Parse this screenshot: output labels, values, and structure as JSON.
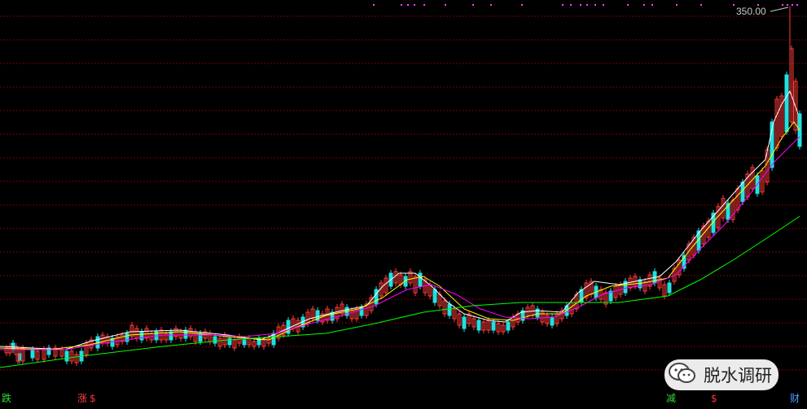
{
  "chart_data": {
    "type": "candlestick",
    "peak_label": "350.00",
    "y_scale": "linear",
    "grid": true,
    "series": [
      {
        "name": "",
        "color": "#ffffff"
      },
      {
        "name": "",
        "color": "#ffff00"
      },
      {
        "name": "",
        "color": "#ff00ff"
      },
      {
        "name": "",
        "color": "#00ff00"
      }
    ],
    "candles": [
      [
        26,
        428,
        16
      ],
      [
        22,
        435,
        8
      ],
      [
        20,
        430,
        14
      ],
      [
        18,
        426,
        10
      ],
      [
        14,
        422,
        8
      ],
      [
        10,
        426,
        8
      ],
      [
        6,
        428,
        6
      ],
      [
        38,
        430,
        10
      ],
      [
        44,
        432,
        10
      ],
      [
        52,
        430,
        12
      ],
      [
        58,
        428,
        8
      ],
      [
        66,
        428,
        10
      ],
      [
        74,
        430,
        8
      ],
      [
        80,
        432,
        12
      ],
      [
        86,
        432,
        12
      ],
      [
        92,
        436,
        10
      ],
      [
        98,
        432,
        12
      ],
      [
        104,
        422,
        14
      ],
      [
        110,
        418,
        10
      ],
      [
        118,
        414,
        14
      ],
      [
        124,
        412,
        10
      ],
      [
        130,
        414,
        8
      ],
      [
        136,
        416,
        10
      ],
      [
        142,
        414,
        10
      ],
      [
        148,
        412,
        8
      ],
      [
        154,
        410,
        10
      ],
      [
        160,
        400,
        14
      ],
      [
        166,
        404,
        12
      ],
      [
        172,
        408,
        10
      ],
      [
        178,
        404,
        12
      ],
      [
        184,
        410,
        8
      ],
      [
        190,
        408,
        10
      ],
      [
        196,
        406,
        12
      ],
      [
        202,
        410,
        8
      ],
      [
        208,
        408,
        10
      ],
      [
        214,
        404,
        10
      ],
      [
        220,
        408,
        8
      ],
      [
        226,
        406,
        10
      ],
      [
        232,
        404,
        10
      ],
      [
        238,
        408,
        12
      ],
      [
        244,
        410,
        10
      ],
      [
        250,
        408,
        8
      ],
      [
        256,
        410,
        10
      ],
      [
        262,
        414,
        8
      ],
      [
        268,
        416,
        10
      ],
      [
        274,
        412,
        12
      ],
      [
        280,
        416,
        8
      ],
      [
        286,
        418,
        10
      ],
      [
        292,
        414,
        8
      ],
      [
        298,
        418,
        6
      ],
      [
        304,
        416,
        8
      ],
      [
        310,
        420,
        6
      ],
      [
        316,
        416,
        8
      ],
      [
        322,
        418,
        8
      ],
      [
        328,
        416,
        6
      ],
      [
        334,
        410,
        14
      ],
      [
        340,
        402,
        14
      ],
      [
        346,
        400,
        12
      ],
      [
        352,
        394,
        16
      ],
      [
        358,
        392,
        12
      ],
      [
        364,
        394,
        14
      ],
      [
        370,
        390,
        12
      ],
      [
        376,
        384,
        14
      ],
      [
        382,
        380,
        12
      ],
      [
        388,
        382,
        12
      ],
      [
        394,
        386,
        10
      ],
      [
        400,
        380,
        14
      ],
      [
        406,
        384,
        10
      ],
      [
        412,
        378,
        14
      ],
      [
        418,
        374,
        12
      ],
      [
        424,
        378,
        10
      ],
      [
        430,
        382,
        10
      ],
      [
        436,
        380,
        12
      ],
      [
        442,
        378,
        10
      ],
      [
        448,
        374,
        14
      ],
      [
        454,
        366,
        16
      ],
      [
        460,
        356,
        18
      ],
      [
        466,
        348,
        16
      ],
      [
        472,
        342,
        18
      ],
      [
        478,
        336,
        16
      ],
      [
        484,
        334,
        14
      ],
      [
        490,
        338,
        12
      ],
      [
        496,
        340,
        12
      ],
      [
        502,
        334,
        14
      ],
      [
        508,
        340,
        20
      ],
      [
        514,
        336,
        16
      ],
      [
        520,
        344,
        16
      ],
      [
        526,
        350,
        14
      ],
      [
        532,
        356,
        16
      ],
      [
        538,
        362,
        14
      ],
      [
        544,
        370,
        16
      ],
      [
        550,
        374,
        14
      ],
      [
        556,
        380,
        12
      ],
      [
        562,
        386,
        14
      ],
      [
        568,
        390,
        14
      ],
      [
        574,
        386,
        12
      ],
      [
        580,
        392,
        10
      ],
      [
        586,
        394,
        12
      ],
      [
        592,
        396,
        10
      ],
      [
        598,
        394,
        12
      ],
      [
        604,
        396,
        10
      ],
      [
        610,
        398,
        10
      ],
      [
        616,
        400,
        8
      ],
      [
        622,
        396,
        10
      ],
      [
        628,
        390,
        12
      ],
      [
        634,
        386,
        10
      ],
      [
        640,
        382,
        12
      ],
      [
        646,
        378,
        10
      ],
      [
        652,
        376,
        12
      ],
      [
        658,
        380,
        10
      ],
      [
        664,
        384,
        12
      ],
      [
        670,
        388,
        10
      ],
      [
        676,
        390,
        10
      ],
      [
        682,
        386,
        12
      ],
      [
        688,
        382,
        10
      ],
      [
        694,
        376,
        12
      ],
      [
        700,
        372,
        14
      ],
      [
        706,
        362,
        18
      ],
      [
        712,
        356,
        16
      ],
      [
        718,
        348,
        18
      ],
      [
        724,
        346,
        16
      ],
      [
        730,
        352,
        14
      ],
      [
        736,
        356,
        12
      ],
      [
        742,
        360,
        14
      ],
      [
        748,
        358,
        12
      ],
      [
        754,
        352,
        14
      ],
      [
        760,
        350,
        12
      ],
      [
        766,
        346,
        14
      ],
      [
        772,
        342,
        12
      ],
      [
        778,
        340,
        12
      ],
      [
        784,
        344,
        10
      ],
      [
        790,
        346,
        12
      ],
      [
        796,
        338,
        14
      ],
      [
        802,
        334,
        14
      ],
      [
        808,
        342,
        12
      ],
      [
        814,
        350,
        14
      ],
      [
        820,
        348,
        12
      ],
      [
        826,
        330,
        16
      ],
      [
        832,
        320,
        18
      ],
      [
        838,
        314,
        16
      ],
      [
        844,
        300,
        20
      ],
      [
        850,
        292,
        22
      ],
      [
        856,
        284,
        24
      ],
      [
        862,
        278,
        22
      ],
      [
        868,
        272,
        20
      ],
      [
        874,
        262,
        24
      ],
      [
        880,
        254,
        26
      ],
      [
        886,
        244,
        24
      ],
      [
        892,
        250,
        20
      ],
      [
        898,
        246,
        24
      ],
      [
        904,
        232,
        26
      ],
      [
        910,
        224,
        24
      ],
      [
        916,
        214,
        28
      ],
      [
        922,
        206,
        26
      ],
      [
        928,
        216,
        22
      ],
      [
        934,
        210,
        26
      ],
      [
        940,
        184,
        40
      ],
      [
        946,
        150,
        56
      ],
      [
        952,
        122,
        60
      ],
      [
        958,
        118,
        50
      ],
      [
        964,
        92,
        70
      ],
      [
        970,
        60,
        90
      ],
      [
        975,
        100,
        60
      ],
      [
        980,
        140,
        40
      ]
    ],
    "ma_lines": [
      {
        "name": "",
        "color": "#ffffff",
        "points": [
          [
            0,
            426
          ],
          [
            40,
            428
          ],
          [
            80,
            430
          ],
          [
            110,
            420
          ],
          [
            160,
            408
          ],
          [
            220,
            406
          ],
          [
            280,
            412
          ],
          [
            320,
            418
          ],
          [
            340,
            410
          ],
          [
            380,
            392
          ],
          [
            420,
            382
          ],
          [
            450,
            376
          ],
          [
            470,
            352
          ],
          [
            490,
            336
          ],
          [
            510,
            336
          ],
          [
            530,
            352
          ],
          [
            550,
            372
          ],
          [
            570,
            386
          ],
          [
            600,
            394
          ],
          [
            620,
            396
          ],
          [
            640,
            384
          ],
          [
            660,
            382
          ],
          [
            690,
            384
          ],
          [
            710,
            360
          ],
          [
            730,
            346
          ],
          [
            760,
            350
          ],
          [
            790,
            344
          ],
          [
            810,
            340
          ],
          [
            830,
            322
          ],
          [
            860,
            284
          ],
          [
            890,
            250
          ],
          [
            920,
            216
          ],
          [
            940,
            196
          ],
          [
            950,
            150
          ],
          [
            960,
            128
          ],
          [
            970,
            112
          ],
          [
            980,
            140
          ]
        ]
      },
      {
        "name": "",
        "color": "#ffff00",
        "points": [
          [
            0,
            428
          ],
          [
            60,
            430
          ],
          [
            110,
            424
          ],
          [
            160,
            412
          ],
          [
            220,
            408
          ],
          [
            280,
            414
          ],
          [
            330,
            418
          ],
          [
            360,
            404
          ],
          [
            400,
            388
          ],
          [
            440,
            380
          ],
          [
            470,
            366
          ],
          [
            500,
            344
          ],
          [
            520,
            340
          ],
          [
            540,
            352
          ],
          [
            570,
            380
          ],
          [
            600,
            392
          ],
          [
            630,
            394
          ],
          [
            660,
            386
          ],
          [
            690,
            386
          ],
          [
            720,
            364
          ],
          [
            750,
            352
          ],
          [
            790,
            348
          ],
          [
            820,
            342
          ],
          [
            850,
            304
          ],
          [
            880,
            268
          ],
          [
            910,
            236
          ],
          [
            940,
            204
          ],
          [
            960,
            170
          ],
          [
            975,
            150
          ],
          [
            982,
            160
          ]
        ]
      },
      {
        "name": "",
        "color": "#ff00ff",
        "points": [
          [
            0,
            430
          ],
          [
            80,
            430
          ],
          [
            140,
            420
          ],
          [
            200,
            412
          ],
          [
            260,
            412
          ],
          [
            300,
            414
          ],
          [
            340,
            410
          ],
          [
            380,
            398
          ],
          [
            420,
            388
          ],
          [
            460,
            376
          ],
          [
            500,
            356
          ],
          [
            530,
            350
          ],
          [
            560,
            362
          ],
          [
            590,
            380
          ],
          [
            620,
            390
          ],
          [
            650,
            392
          ],
          [
            680,
            390
          ],
          [
            710,
            378
          ],
          [
            740,
            362
          ],
          [
            770,
            354
          ],
          [
            800,
            350
          ],
          [
            830,
            338
          ],
          [
            860,
            306
          ],
          [
            890,
            276
          ],
          [
            920,
            240
          ],
          [
            950,
            200
          ],
          [
            970,
            180
          ],
          [
            982,
            168
          ]
        ]
      },
      {
        "name": "",
        "color": "#00ff00",
        "points": [
          [
            0,
            452
          ],
          [
            100,
            438
          ],
          [
            200,
            426
          ],
          [
            280,
            418
          ],
          [
            340,
            414
          ],
          [
            400,
            410
          ],
          [
            460,
            398
          ],
          [
            520,
            384
          ],
          [
            580,
            376
          ],
          [
            640,
            372
          ],
          [
            700,
            372
          ],
          [
            760,
            372
          ],
          [
            820,
            364
          ],
          [
            860,
            344
          ],
          [
            900,
            320
          ],
          [
            940,
            294
          ],
          [
            970,
            274
          ],
          [
            982,
            266
          ]
        ]
      }
    ]
  },
  "markers": {
    "die": "跌",
    "zhang": "涨",
    "s1": "$",
    "jian": "减",
    "s2": "$",
    "cai": "财"
  },
  "watermark": {
    "icon": "wechat-icon",
    "text": "脱水调研"
  },
  "colors": {
    "up": "#ff3a3a",
    "down": "#22e0e0",
    "grid": "#7a0000",
    "background": "#000000"
  }
}
